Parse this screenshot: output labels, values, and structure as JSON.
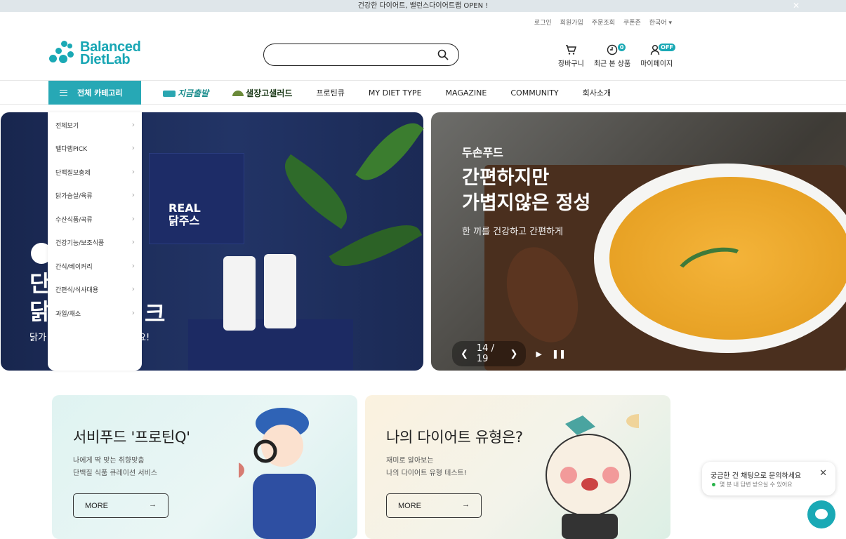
{
  "announcement": "건강한 다이어트, 밸런스다이어트랩 OPEN !",
  "util_links": [
    "로그인",
    "회원가입",
    "주문조회",
    "쿠폰존",
    "한국어"
  ],
  "logo": {
    "line1": "Balanced",
    "line2": "DietLab"
  },
  "search": {
    "placeholder": ""
  },
  "header_icons": {
    "cart": {
      "label": "장바구니"
    },
    "recent": {
      "label": "최근 본 상품",
      "badge": "0"
    },
    "mypage": {
      "label": "마이페이지",
      "badge": "OFF"
    }
  },
  "nav": {
    "category_button": "전체 카테고리",
    "items": [
      "지금출발",
      "샐장고샐러드",
      "프로틴큐",
      "MY DIET TYPE",
      "MAGAZINE",
      "COMMUNITY",
      "회사소개"
    ]
  },
  "category_menu": [
    "전체보기",
    "밸다랩PICK",
    "단백질보충제",
    "닭가슴살/육류",
    "수산식품/곡류",
    "건강기능/보조식품",
    "간식/베이커리",
    "간편식/식사대용",
    "과일/채소"
  ],
  "banner_left": {
    "box_text_line1": "REAL",
    "box_text_line2": "닭주스",
    "title_line1": "단",
    "title_line2": "닭",
    "title_tail": "크",
    "subtitle_head": "닭가",
    "subtitle_tail": "요!"
  },
  "banner_right": {
    "brand": "두손푸드",
    "title_line1": "간편하지만",
    "title_line2": "가볍지않은 정성",
    "subtitle": "한 끼를 건강하고 간편하게",
    "pager": "14 / 19"
  },
  "cards": [
    {
      "title": "서비푸드 '프로틴Q'",
      "desc1": "나에게 딱 맞는 취향맞춤",
      "desc2": "단백질 식품 큐레이션 서비스",
      "button": "MORE"
    },
    {
      "title": "나의 다이어트 유형은?",
      "desc1": "재미로 알아보는",
      "desc2": "나의 다이어트 유형 테스트!",
      "button": "MORE"
    }
  ],
  "chat": {
    "title": "궁금한 건 채팅으로 문의하세요",
    "status": "몇 분 내 답변 받으실 수 있어요"
  },
  "colors": {
    "brand": "#1aa9b5",
    "nav_button": "#27a8b5"
  }
}
